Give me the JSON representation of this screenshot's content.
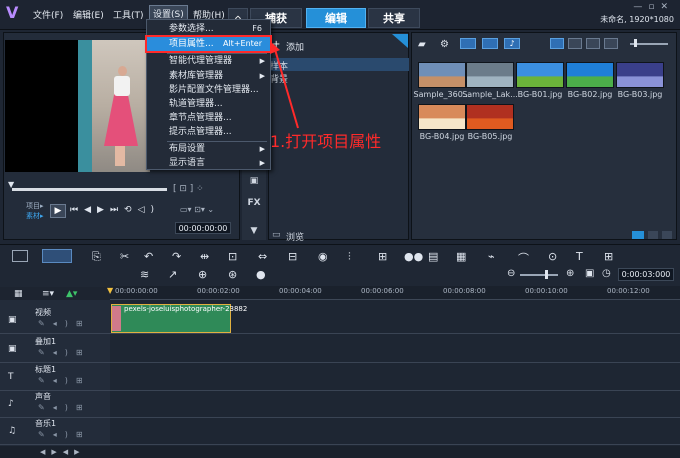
{
  "app": {
    "title_info": "未命名, 1920*1080"
  },
  "menu": {
    "file": "文件(F)",
    "edit": "编辑(E)",
    "tools": "工具(T)",
    "settings": "设置(S)",
    "help": "帮助(H)"
  },
  "tabs": {
    "capture": "捕获",
    "edit": "编辑",
    "share": "共享"
  },
  "dropdown": {
    "items": [
      {
        "label": "参数选择...",
        "shortcut": "F6"
      },
      {
        "label": "项目属性...",
        "shortcut": "Alt+Enter"
      },
      {
        "label": "智能代理管理器"
      },
      {
        "label": "素材库管理器"
      },
      {
        "label": "影片配置文件管理器..."
      },
      {
        "label": "轨道管理器..."
      },
      {
        "label": "章节点管理器..."
      },
      {
        "label": "提示点管理器..."
      },
      {
        "label": "布局设置"
      },
      {
        "label": "显示语言"
      }
    ]
  },
  "annotation": "1.打开项目属性",
  "preview": {
    "project_label": "项目▸",
    "clip_label": "素材▸",
    "timecode": "00:00:00:00"
  },
  "library": {
    "add_label": "添加",
    "items": [
      "样本",
      "背景"
    ],
    "browse_label": "浏览"
  },
  "media": {
    "thumbnails": [
      {
        "label": "Sample_360...",
        "colors": [
          "#6f8fb8",
          "#c59068"
        ]
      },
      {
        "label": "Sample_Lak...",
        "colors": [
          "#6b7c8a",
          "#9fb3c0"
        ]
      },
      {
        "label": "BG-B01.jpg",
        "colors": [
          "#3b8fe0",
          "#6bb33a"
        ]
      },
      {
        "label": "BG-B02.jpg",
        "colors": [
          "#1f7fd8",
          "#4cae4a"
        ]
      },
      {
        "label": "BG-B03.jpg",
        "colors": [
          "#3a3f8a",
          "#8a92d8"
        ]
      },
      {
        "label": "BG-B04.jpg",
        "colors": [
          "#d88a5a",
          "#f6e6c8"
        ]
      },
      {
        "label": "BG-B05.jpg",
        "colors": [
          "#b03020",
          "#e05b20"
        ]
      }
    ]
  },
  "timeline": {
    "timecode": "0:00:03:000",
    "ruler": [
      "00:00:00:00",
      "00:00:02:00",
      "00:00:04:00",
      "00:00:06:00",
      "00:00:08:00",
      "00:00:10:00",
      "00:00:12:00"
    ],
    "tracks": [
      "视频",
      "叠加1",
      "标题1",
      "声音",
      "音乐1"
    ],
    "clip_name": "pexels-joseluisphotographer-23882"
  },
  "colors": {
    "accent": "#2590d8",
    "annotation": "#ff2a2a"
  }
}
